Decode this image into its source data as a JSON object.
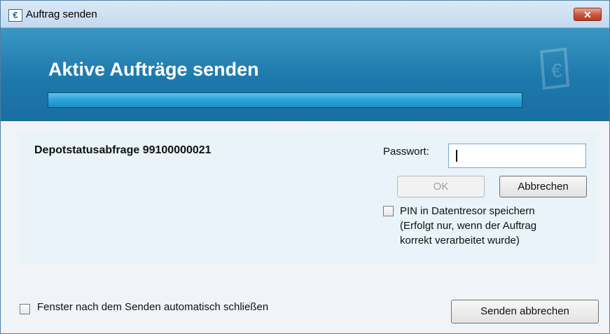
{
  "window": {
    "title": "Auftrag senden",
    "app_icon": "€",
    "close_symbol": "✕"
  },
  "banner": {
    "heading": "Aktive Aufträge senden",
    "progress": 1.0
  },
  "task": {
    "label": "Depotstatusabfrage 99100000021"
  },
  "password": {
    "label": "Passwort:",
    "value": ""
  },
  "buttons": {
    "ok": "OK",
    "cancel": "Abbrechen",
    "cancel_send": "Senden abbrechen"
  },
  "pin_option": {
    "line1": "PIN in Datentresor speichern",
    "line2": "(Erfolgt nur, wenn der Auftrag",
    "line3": "korrekt verarbeitet wurde)",
    "checked": false
  },
  "footer": {
    "auto_close_label": "Fenster nach dem Senden automatisch schließen",
    "checked": false
  }
}
